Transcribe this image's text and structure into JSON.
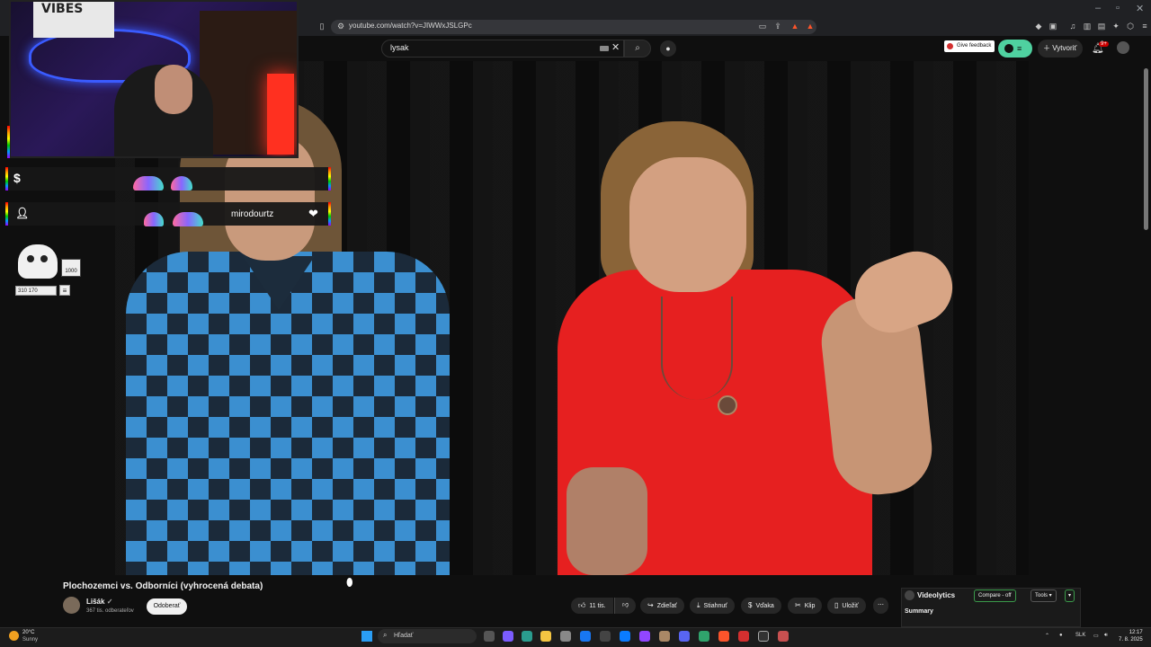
{
  "browser": {
    "url": "youtube.com/watch?v=JIWWxJSLGPc"
  },
  "youtube": {
    "search_value": "lysak",
    "feedback_label": "Give feedback",
    "create_label": "Vytvoriť",
    "notification_count": "9+"
  },
  "video": {
    "title": "Plochozemci vs. Odborníci (vyhrocená debata)"
  },
  "channel": {
    "name": "Lišák",
    "subscribers": "367 tis. odberateľov",
    "subscribe_label": "Odoberať"
  },
  "actions": {
    "likes": "11 tis.",
    "share": "Zdieľať",
    "download": "Stiahnuť",
    "thanks": "Vďaka",
    "clip": "Klip",
    "save": "Uložiť"
  },
  "videolytics": {
    "title": "Videolytics",
    "compare": "Compare - off",
    "tools": "Tools",
    "summary": "Summary"
  },
  "overlay": {
    "webcam_text": "VIBES",
    "alert_name": "mirodourtz",
    "goal_target": "1000",
    "goal_count": "310 170"
  },
  "taskbar": {
    "temperature": "20°C",
    "weather": "Sunny",
    "search_label": "Hľadať",
    "language": "SLK",
    "time": "12:17",
    "date": "7. 8. 2025"
  },
  "colors": {
    "youtube_bg": "#0f0f0f",
    "accent_green": "#4fd1a0",
    "shirt_red": "#e62020",
    "plaid_blue": "#3b8fd0"
  }
}
